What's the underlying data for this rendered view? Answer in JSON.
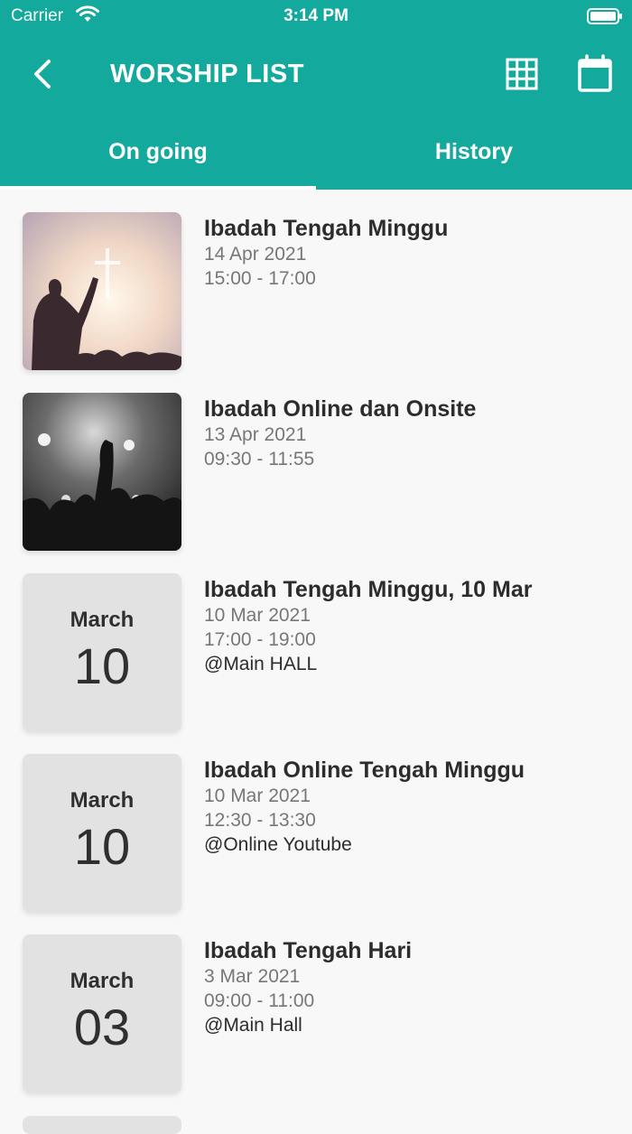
{
  "status": {
    "carrier": "Carrier",
    "time": "3:14 PM"
  },
  "header": {
    "title": "WORSHIP LIST"
  },
  "tabs": [
    {
      "label": "On going"
    },
    {
      "label": "History"
    }
  ],
  "colors": {
    "primary": "#14a99d",
    "tile": "#e2e2e2"
  },
  "icons": {
    "back": "chevron-left",
    "grid": "grid-view",
    "calendar": "calendar"
  },
  "items": [
    {
      "name": "Ibadah Tengah Minggu",
      "date": "14 Apr 2021",
      "time": "15:00 - 17:00",
      "location": ""
    },
    {
      "name": "Ibadah Online dan Onsite",
      "date": "13 Apr 2021",
      "time": "09:30 - 11:55",
      "location": ""
    },
    {
      "name": "Ibadah Tengah Minggu, 10 Mar",
      "date": "10 Mar 2021",
      "time": "17:00 - 19:00",
      "location": "@Main HALL",
      "month": "March",
      "day": "10"
    },
    {
      "name": "Ibadah Online Tengah Minggu",
      "date": "10 Mar 2021",
      "time": "12:30 - 13:30",
      "location": "@Online Youtube",
      "month": "March",
      "day": "10"
    },
    {
      "name": "Ibadah Tengah Hari",
      "date": "3 Mar 2021",
      "time": "09:00 - 11:00",
      "location": "@Main Hall",
      "month": "March",
      "day": "03"
    }
  ]
}
